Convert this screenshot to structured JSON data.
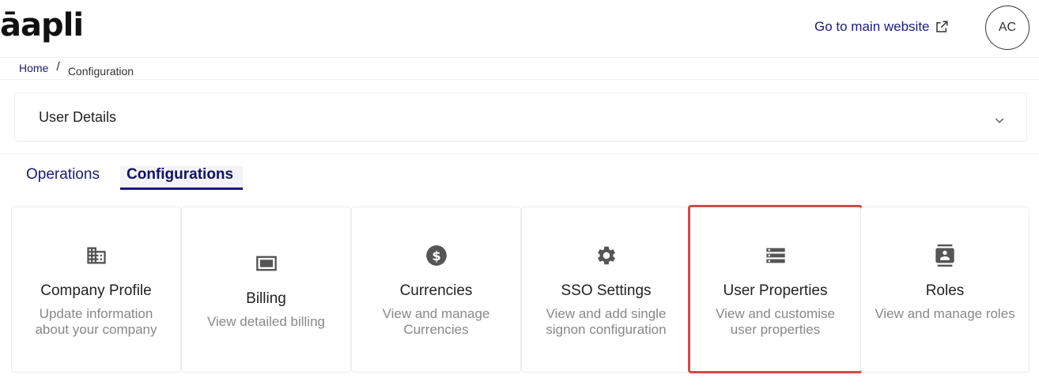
{
  "header": {
    "logo": "āapli",
    "main_link": "Go to main website",
    "avatar_initials": "AC"
  },
  "breadcrumb": {
    "home": "Home",
    "separator": "/",
    "current": "Configuration"
  },
  "accordion": {
    "title": "User Details"
  },
  "tabs": {
    "operations": "Operations",
    "configurations": "Configurations",
    "active": "configurations"
  },
  "cards": [
    {
      "title": "Company Profile",
      "desc": "Update information about your company",
      "icon": "building-icon"
    },
    {
      "title": "Billing",
      "desc": "View detailed billing",
      "icon": "billing-icon"
    },
    {
      "title": "Currencies",
      "desc": "View and manage Currencies",
      "icon": "currency-icon"
    },
    {
      "title": "SSO Settings",
      "desc": "View and add single signon configuration",
      "icon": "gear-icon"
    },
    {
      "title": "User Properties",
      "desc": "View and customise user properties",
      "icon": "list-icon",
      "highlighted": true
    },
    {
      "title": "Roles",
      "desc": "View and manage roles",
      "icon": "roles-icon"
    }
  ],
  "colors": {
    "brand": "#1a1a7a",
    "highlight": "#d04a4a",
    "muted_text": "#888888"
  }
}
